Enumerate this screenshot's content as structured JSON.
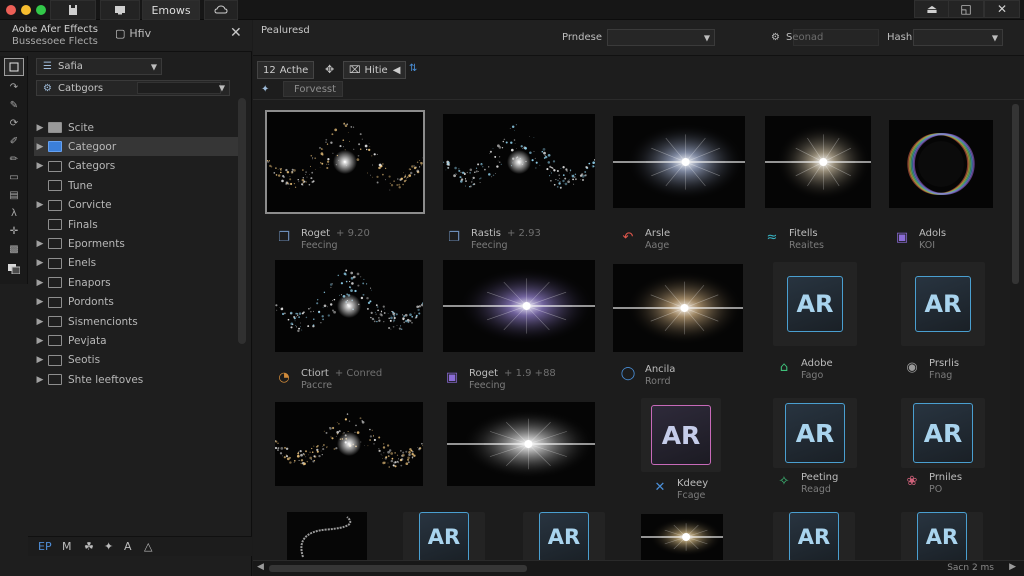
{
  "titlebar": {
    "tab_label": "Emows",
    "traffic_colors": [
      "#ec5f56",
      "#f6bd2f",
      "#32c849"
    ],
    "controls": [
      "⏏",
      "◱",
      "✕"
    ]
  },
  "left_panel": {
    "title_line1": "Aobe Afer Effects",
    "title_line2": "Bussesoee Flects",
    "tab_label": "Hfiv",
    "close_symbol": "✕",
    "scope_dropdown": "Safia",
    "category_dropdown": "Catbgors",
    "tree": [
      {
        "label": "Scite",
        "expandable": true,
        "folder": "filled"
      },
      {
        "label": "Categoor",
        "expandable": true,
        "folder": "blue",
        "selected": true
      },
      {
        "label": "Categors",
        "expandable": true,
        "folder": "outline"
      },
      {
        "label": "Tune",
        "expandable": false,
        "folder": "outline"
      },
      {
        "label": "Corvicte",
        "expandable": true,
        "folder": "outline"
      },
      {
        "label": "Finals",
        "expandable": false,
        "folder": "outline"
      },
      {
        "label": "Eporments",
        "expandable": true,
        "folder": "outline"
      },
      {
        "label": "Enels",
        "expandable": true,
        "folder": "outline"
      },
      {
        "label": "Enapors",
        "expandable": true,
        "folder": "outline"
      },
      {
        "label": "Pordonts",
        "expandable": true,
        "folder": "outline"
      },
      {
        "label": "Sismencionts",
        "expandable": true,
        "folder": "outline"
      },
      {
        "label": "Pevjata",
        "expandable": true,
        "folder": "outline"
      },
      {
        "label": "Seotis",
        "expandable": true,
        "folder": "outline"
      },
      {
        "label": "Shte leeftoves",
        "expandable": true,
        "folder": "outline"
      }
    ],
    "footer_icons": [
      "EP",
      "M",
      "☘",
      "✦",
      "A",
      "△"
    ]
  },
  "main": {
    "title": "Pealuresd",
    "preset_label": "Prndese",
    "search_label": "Seonad",
    "hash_label": "Hash",
    "toolbar": {
      "btn1": "Acthe",
      "btn1_icon": "12",
      "btn2": "Hitie",
      "btn2_icon": "⌧",
      "sub_label": "Forvesst"
    },
    "row1": [
      {
        "name": "Roget",
        "sub": "Feecing",
        "extra": "+ 9.20",
        "icon_color": "#6c8db8"
      },
      {
        "name": "Rastis",
        "sub": "Feecing",
        "extra": "+ 2.93",
        "icon_color": "#6c8db8"
      },
      {
        "name": "Arsle",
        "sub": "Aage",
        "extra": "",
        "icon_color": "#e1574c"
      },
      {
        "name": "Fitells",
        "sub": "Reaites",
        "extra": "",
        "icon_color": "#38b6c6"
      },
      {
        "name": "Adols",
        "sub": "KOI",
        "extra": "",
        "icon_color": "#8a6cd6"
      }
    ],
    "row2": [
      {
        "name": "Ctiort",
        "sub": "Paccre",
        "extra": "+ Conred",
        "icon_color": "#d08a3a"
      },
      {
        "name": "Roget",
        "sub": "Feecing",
        "extra": "+ 1.9 +88",
        "icon_color": "#8a6cd6"
      },
      {
        "name": "Ancila",
        "sub": "Rorrd",
        "extra": "",
        "icon_color": "#4a8fd8"
      },
      {
        "name": "Adobe",
        "sub": "Fago",
        "extra": "",
        "icon_color": "#3fc07a"
      },
      {
        "name": "Prsrlis",
        "sub": "Fnag",
        "extra": "",
        "icon_color": "#9a9a9a"
      }
    ],
    "row3": [
      {
        "name": "Kdeey",
        "sub": "Fcage",
        "extra": "",
        "icon_color": "#4a8fd8"
      },
      {
        "name": "Peeting",
        "sub": "Reagd",
        "extra": "",
        "icon_color": "#3fc07a"
      },
      {
        "name": "Prniles",
        "sub": "PO",
        "extra": "",
        "icon_color": "#d0617a"
      }
    ],
    "ar_text": "AR",
    "footer": "Sacn 2 ms"
  }
}
